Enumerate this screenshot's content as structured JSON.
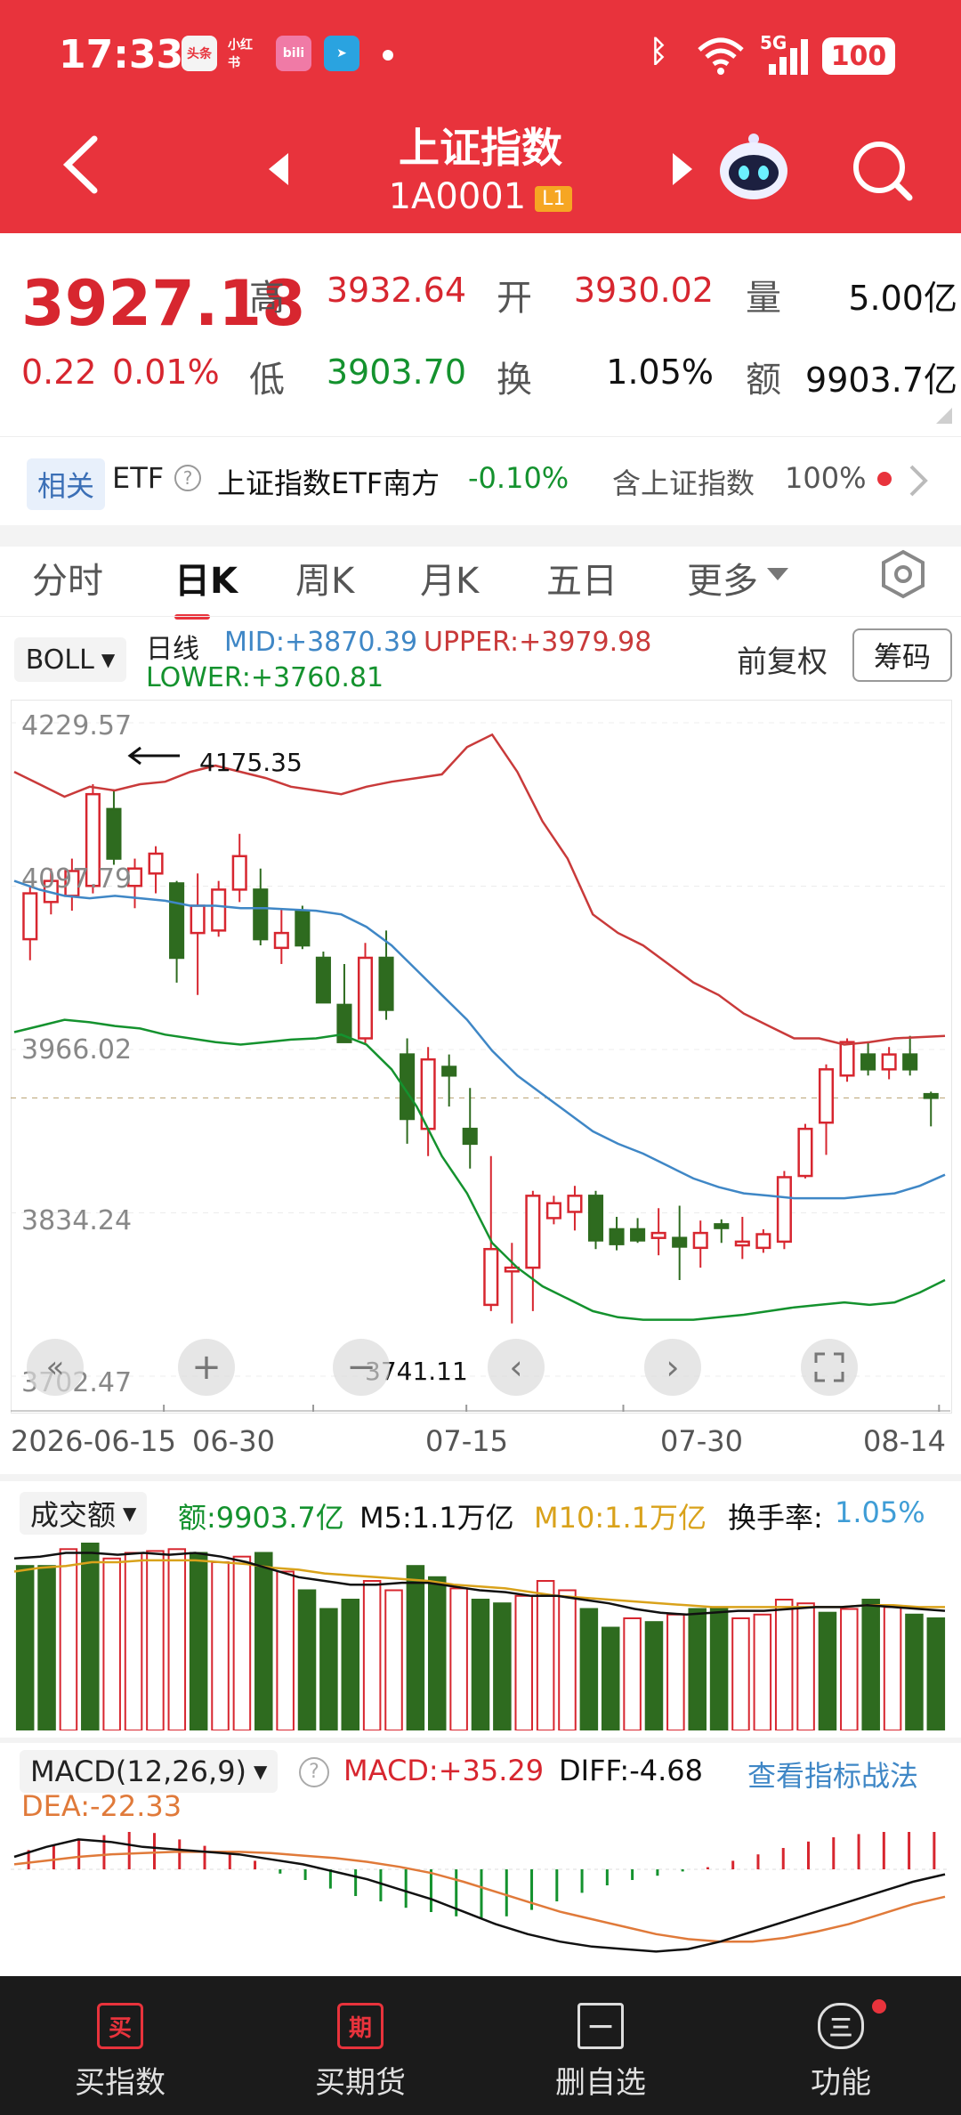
{
  "status_bar": {
    "time": "17:33",
    "network": "5G",
    "battery": "100"
  },
  "header": {
    "title": "上证指数",
    "code": "1A0001",
    "level_badge": "L1"
  },
  "quote": {
    "price": "3927.18",
    "change": "0.22",
    "change_pct": "0.01%",
    "high_label": "高",
    "high": "3932.64",
    "open_label": "开",
    "open": "3930.02",
    "vol_label": "量",
    "volume": "5.00亿",
    "low_label": "低",
    "low": "3903.70",
    "turnover_label": "换",
    "turnover": "1.05%",
    "amount_label": "额",
    "amount": "9903.7亿"
  },
  "etf": {
    "tag": "相关",
    "etf_label": "ETF",
    "name": "上证指数ETF南方",
    "change": "-0.10%",
    "contains_label": "含上证指数",
    "contains_pct": "100%"
  },
  "tabs": [
    "分时",
    "日K",
    "周K",
    "月K",
    "五日",
    "更多"
  ],
  "boll": {
    "selector": "BOLL",
    "period": "日线",
    "mid": "MID:+3870.39",
    "upper": "UPPER:+3979.98",
    "lower": "LOWER:+3760.81",
    "adjust": "前复权",
    "chips": "筹码"
  },
  "price_axis": [
    "4229.57",
    "4097.79",
    "3966.02",
    "3834.24",
    "3702.47"
  ],
  "annotations": {
    "high_marker": "4175.35",
    "low_marker": "3741.11"
  },
  "date_axis": [
    "2026-06-15",
    "06-30",
    "07-15",
    "07-30",
    "08-14"
  ],
  "volume_panel": {
    "selector": "成交额",
    "amount": "额:9903.7亿",
    "m5": "M5:1.1万亿",
    "m10": "M10:1.1万亿",
    "turnover_label": "换手率:",
    "turnover": "1.05%"
  },
  "macd_panel": {
    "selector": "MACD(12,26,9)",
    "macd": "MACD:+35.29",
    "diff": "DIFF:-4.68",
    "link": "查看指标战法",
    "dea": "DEA:-22.33"
  },
  "bottom_nav": [
    {
      "icon": "买",
      "label": "买指数"
    },
    {
      "icon": "期",
      "label": "买期货"
    },
    {
      "icon": "一",
      "label": "删自选"
    },
    {
      "icon": "三",
      "label": "功能"
    }
  ],
  "colors": {
    "up": "#d7262f",
    "down": "#2e6b1f",
    "header": "#e8333c",
    "mid_line": "#3f87c6",
    "lower_line": "#14922e",
    "m10_line": "#d9a21b"
  },
  "chart_data": {
    "type": "candlestick",
    "ylim": [
      3702.47,
      4229.57
    ],
    "x_ticks": [
      "2026-06-15",
      "06-30",
      "07-15",
      "07-30",
      "08-14"
    ],
    "candles": [
      {
        "o": 4055,
        "h": 4098,
        "l": 4038,
        "c": 4092
      },
      {
        "o": 4085,
        "h": 4112,
        "l": 4075,
        "c": 4102
      },
      {
        "o": 4090,
        "h": 4120,
        "l": 4078,
        "c": 4110
      },
      {
        "o": 4098,
        "h": 4180,
        "l": 4092,
        "c": 4172
      },
      {
        "o": 4160,
        "h": 4175,
        "l": 4115,
        "c": 4120
      },
      {
        "o": 4098,
        "h": 4120,
        "l": 4080,
        "c": 4112
      },
      {
        "o": 4108,
        "h": 4130,
        "l": 4092,
        "c": 4124
      },
      {
        "o": 4100,
        "h": 4102,
        "l": 4020,
        "c": 4040
      },
      {
        "o": 4060,
        "h": 4108,
        "l": 4010,
        "c": 4082
      },
      {
        "o": 4062,
        "h": 4102,
        "l": 4057,
        "c": 4095
      },
      {
        "o": 4095,
        "h": 4140,
        "l": 4085,
        "c": 4122
      },
      {
        "o": 4095,
        "h": 4112,
        "l": 4050,
        "c": 4055
      },
      {
        "o": 4048,
        "h": 4080,
        "l": 4035,
        "c": 4060
      },
      {
        "o": 4078,
        "h": 4082,
        "l": 4047,
        "c": 4050
      },
      {
        "o": 4040,
        "h": 4045,
        "l": 4010,
        "c": 4004
      },
      {
        "o": 4002,
        "h": 4035,
        "l": 3980,
        "c": 3972
      },
      {
        "o": 3975,
        "h": 4052,
        "l": 3970,
        "c": 4040
      },
      {
        "o": 4040,
        "h": 4062,
        "l": 3990,
        "c": 3998
      },
      {
        "o": 3962,
        "h": 3975,
        "l": 3890,
        "c": 3910
      },
      {
        "o": 3902,
        "h": 3968,
        "l": 3880,
        "c": 3958
      },
      {
        "o": 3952,
        "h": 3962,
        "l": 3920,
        "c": 3945
      },
      {
        "o": 3902,
        "h": 3935,
        "l": 3870,
        "c": 3890
      },
      {
        "o": 3760,
        "h": 3880,
        "l": 3755,
        "c": 3805
      },
      {
        "o": 3787,
        "h": 3810,
        "l": 3745,
        "c": 3790
      },
      {
        "o": 3790,
        "h": 3852,
        "l": 3755,
        "c": 3848
      },
      {
        "o": 3830,
        "h": 3848,
        "l": 3825,
        "c": 3842
      },
      {
        "o": 3835,
        "h": 3856,
        "l": 3820,
        "c": 3848
      },
      {
        "o": 3848,
        "h": 3852,
        "l": 3805,
        "c": 3812
      },
      {
        "o": 3821,
        "h": 3831,
        "l": 3804,
        "c": 3809
      },
      {
        "o": 3821,
        "h": 3830,
        "l": 3810,
        "c": 3812
      },
      {
        "o": 3814,
        "h": 3838,
        "l": 3800,
        "c": 3818
      },
      {
        "o": 3814,
        "h": 3840,
        "l": 3780,
        "c": 3807
      },
      {
        "o": 3806,
        "h": 3828,
        "l": 3790,
        "c": 3818
      },
      {
        "o": 3825,
        "h": 3829,
        "l": 3810,
        "c": 3822
      },
      {
        "o": 3808,
        "h": 3831,
        "l": 3797,
        "c": 3811
      },
      {
        "o": 3806,
        "h": 3821,
        "l": 3802,
        "c": 3817
      },
      {
        "o": 3811,
        "h": 3868,
        "l": 3805,
        "c": 3863
      },
      {
        "o": 3864,
        "h": 3906,
        "l": 3862,
        "c": 3902
      },
      {
        "o": 3907,
        "h": 3954,
        "l": 3881,
        "c": 3950
      },
      {
        "o": 3945,
        "h": 3975,
        "l": 3940,
        "c": 3972
      },
      {
        "o": 3962,
        "h": 3972,
        "l": 3945,
        "c": 3950
      },
      {
        "o": 3950,
        "h": 3968,
        "l": 3942,
        "c": 3962
      },
      {
        "o": 3962,
        "h": 3977,
        "l": 3945,
        "c": 3950
      },
      {
        "o": 3930,
        "h": 3932,
        "l": 3904,
        "c": 3927
      }
    ],
    "upper": [
      4190,
      4180,
      4170,
      4178,
      4175,
      4180,
      4182,
      4190,
      4195,
      4190,
      4185,
      4178,
      4175,
      4172,
      4178,
      4182,
      4185,
      4188,
      4210,
      4220,
      4190,
      4150,
      4120,
      4075,
      4060,
      4050,
      4035,
      4020,
      4010,
      3995,
      3985,
      3975,
      3975,
      3970,
      3972,
      3975,
      3976,
      3977
    ],
    "mid": [
      4102,
      4095,
      4090,
      4088,
      4090,
      4088,
      4086,
      4082,
      4082,
      4080,
      4080,
      4079,
      4078,
      4075,
      4065,
      4050,
      4030,
      4010,
      3990,
      3965,
      3945,
      3930,
      3915,
      3900,
      3890,
      3882,
      3872,
      3862,
      3855,
      3850,
      3848,
      3846,
      3846,
      3846,
      3848,
      3850,
      3856,
      3865
    ],
    "lower": [
      3980,
      3985,
      3990,
      3988,
      3985,
      3983,
      3978,
      3975,
      3972,
      3970,
      3972,
      3974,
      3975,
      3978,
      3970,
      3950,
      3920,
      3880,
      3850,
      3810,
      3790,
      3775,
      3765,
      3755,
      3750,
      3748,
      3748,
      3748,
      3750,
      3752,
      3755,
      3758,
      3760,
      3762,
      3760,
      3762,
      3770,
      3780
    ],
    "volume": [
      {
        "v": 0.88,
        "up": false
      },
      {
        "v": 0.88,
        "up": false
      },
      {
        "v": 0.97,
        "up": true
      },
      {
        "v": 1.0,
        "up": false
      },
      {
        "v": 0.92,
        "up": true
      },
      {
        "v": 0.95,
        "up": true
      },
      {
        "v": 0.96,
        "up": true
      },
      {
        "v": 0.97,
        "up": true
      },
      {
        "v": 0.95,
        "up": false
      },
      {
        "v": 0.9,
        "up": true
      },
      {
        "v": 0.93,
        "up": true
      },
      {
        "v": 0.95,
        "up": false
      },
      {
        "v": 0.85,
        "up": true
      },
      {
        "v": 0.75,
        "up": false
      },
      {
        "v": 0.65,
        "up": false
      },
      {
        "v": 0.7,
        "up": false
      },
      {
        "v": 0.8,
        "up": true
      },
      {
        "v": 0.75,
        "up": true
      },
      {
        "v": 0.88,
        "up": false
      },
      {
        "v": 0.82,
        "up": false
      },
      {
        "v": 0.76,
        "up": true
      },
      {
        "v": 0.7,
        "up": false
      },
      {
        "v": 0.68,
        "up": false
      },
      {
        "v": 0.72,
        "up": true
      },
      {
        "v": 0.8,
        "up": true
      },
      {
        "v": 0.75,
        "up": true
      },
      {
        "v": 0.65,
        "up": false
      },
      {
        "v": 0.55,
        "up": false
      },
      {
        "v": 0.6,
        "up": true
      },
      {
        "v": 0.58,
        "up": false
      },
      {
        "v": 0.62,
        "up": true
      },
      {
        "v": 0.65,
        "up": false
      },
      {
        "v": 0.66,
        "up": false
      },
      {
        "v": 0.6,
        "up": true
      },
      {
        "v": 0.62,
        "up": true
      },
      {
        "v": 0.7,
        "up": true
      },
      {
        "v": 0.68,
        "up": true
      },
      {
        "v": 0.63,
        "up": false
      },
      {
        "v": 0.65,
        "up": true
      },
      {
        "v": 0.7,
        "up": false
      },
      {
        "v": 0.66,
        "up": true
      },
      {
        "v": 0.62,
        "up": false
      },
      {
        "v": 0.6,
        "up": false
      }
    ],
    "m5": [
      0.92,
      0.93,
      0.95,
      0.95,
      0.94,
      0.95,
      0.94,
      0.95,
      0.93,
      0.9,
      0.86,
      0.82,
      0.8,
      0.78,
      0.78,
      0.79,
      0.79,
      0.77,
      0.75,
      0.74,
      0.72,
      0.72,
      0.7,
      0.68,
      0.65,
      0.63,
      0.62,
      0.63,
      0.64,
      0.64,
      0.65,
      0.66,
      0.66,
      0.67,
      0.66,
      0.65,
      0.64
    ],
    "m10": [
      0.85,
      0.87,
      0.88,
      0.9,
      0.9,
      0.91,
      0.91,
      0.91,
      0.9,
      0.89,
      0.87,
      0.86,
      0.84,
      0.83,
      0.82,
      0.81,
      0.8,
      0.78,
      0.77,
      0.76,
      0.74,
      0.72,
      0.71,
      0.7,
      0.69,
      0.68,
      0.67,
      0.66,
      0.66,
      0.66,
      0.66,
      0.66,
      0.66,
      0.67,
      0.67,
      0.66,
      0.66
    ],
    "macd_hist": [
      18,
      22,
      28,
      32,
      35,
      34,
      28,
      22,
      14,
      8,
      -4,
      -10,
      -18,
      -25,
      -30,
      -36,
      -40,
      -44,
      -46,
      -44,
      -38,
      -30,
      -22,
      -15,
      -10,
      -6,
      -2,
      2,
      8,
      14,
      20,
      26,
      30,
      33,
      35,
      35,
      35
    ],
    "diff": [
      10,
      18,
      24,
      22,
      18,
      16,
      14,
      12,
      8,
      4,
      -2,
      -8,
      -16,
      -24,
      -34,
      -44,
      -52,
      -58,
      -62,
      -64,
      -66,
      -64,
      -58,
      -50,
      -42,
      -34,
      -26,
      -18,
      -10,
      -4
    ],
    "dea": [
      4,
      7,
      10,
      12,
      13,
      14,
      14,
      14,
      13,
      11,
      9,
      6,
      2,
      -3,
      -10,
      -18,
      -26,
      -34,
      -40,
      -46,
      -52,
      -56,
      -58,
      -58,
      -55,
      -50,
      -44,
      -36,
      -28,
      -22
    ]
  }
}
